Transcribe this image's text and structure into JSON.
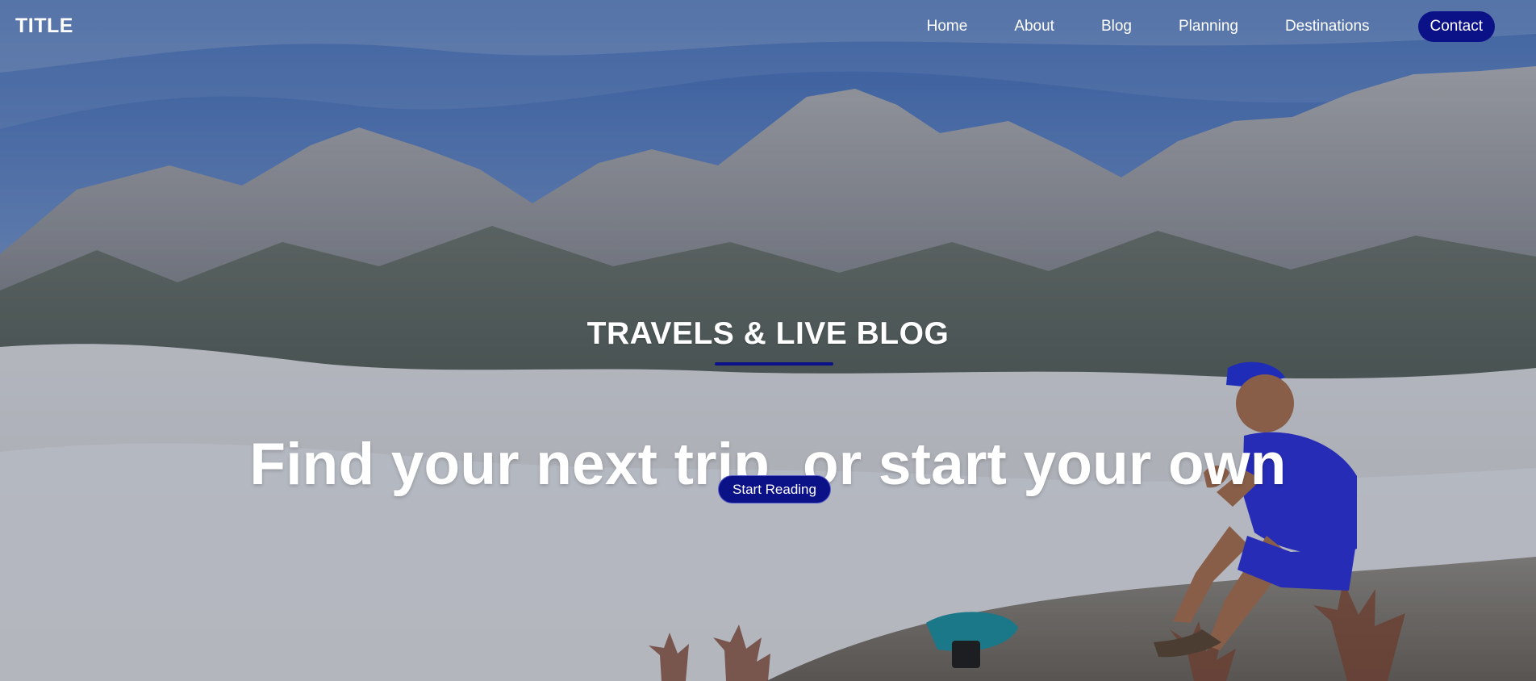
{
  "brand": {
    "title": "TITLE"
  },
  "navigation": {
    "items": [
      {
        "label": "Home"
      },
      {
        "label": "About"
      },
      {
        "label": "Blog"
      },
      {
        "label": "Planning"
      },
      {
        "label": "Destinations"
      }
    ],
    "contact_label": "Contact"
  },
  "hero": {
    "kicker": "TRAVELS & LIVE BLOG",
    "headline": "Find your next trip, or start your own",
    "cta_label": "Start Reading"
  },
  "colors": {
    "accent": "#0b1186",
    "text": "#ffffff"
  }
}
